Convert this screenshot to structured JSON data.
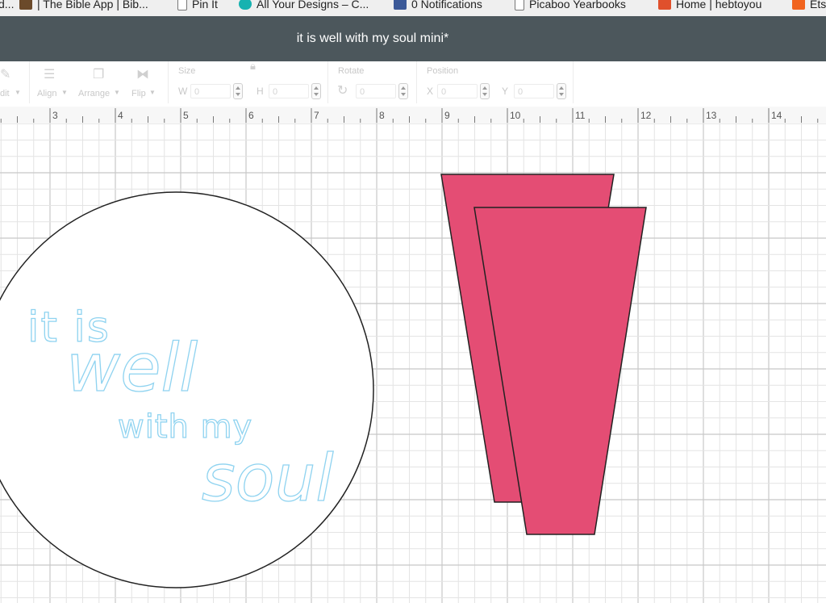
{
  "bookmarks": [
    {
      "label": "d...",
      "icon": "page-icon"
    },
    {
      "label": "| The Bible App | Bib...",
      "icon": "bible-app-icon"
    },
    {
      "label": "Pin It",
      "icon": "page-icon"
    },
    {
      "label": "All Your Designs – C...",
      "icon": "cricut-icon"
    },
    {
      "label": "0 Notifications",
      "icon": "facebook-icon"
    },
    {
      "label": "Picaboo Yearbooks",
      "icon": "page-icon"
    },
    {
      "label": "Home | hebtoyou",
      "icon": "etsy-shop-icon"
    },
    {
      "label": "Ets",
      "icon": "etsy-icon"
    }
  ],
  "window": {
    "title": "it is well with my soul mini*"
  },
  "toolbar": {
    "edit_label": "dit",
    "align_label": "Align",
    "arrange_label": "Arrange",
    "flip_label": "Flip",
    "size_label": "Size",
    "w_label": "W",
    "w_value": "0",
    "h_label": "H",
    "h_value": "0",
    "rotate_label": "Rotate",
    "rotate_value": "0",
    "position_label": "Position",
    "x_label": "X",
    "x_value": "0",
    "y_label": "Y",
    "y_value": "0"
  },
  "ruler": {
    "labels": [
      "3",
      "4",
      "5",
      "6",
      "7",
      "8",
      "9",
      "10",
      "11",
      "12",
      "13",
      "14"
    ]
  },
  "design": {
    "text_lines": [
      "it is",
      "well",
      "with my",
      "soul"
    ],
    "colors": {
      "text": "#8fd3f0",
      "shape_fill": "#e44d74",
      "outline": "#222222",
      "grid_minor": "#e4e4e4",
      "grid_major": "#c8c8c8"
    }
  }
}
